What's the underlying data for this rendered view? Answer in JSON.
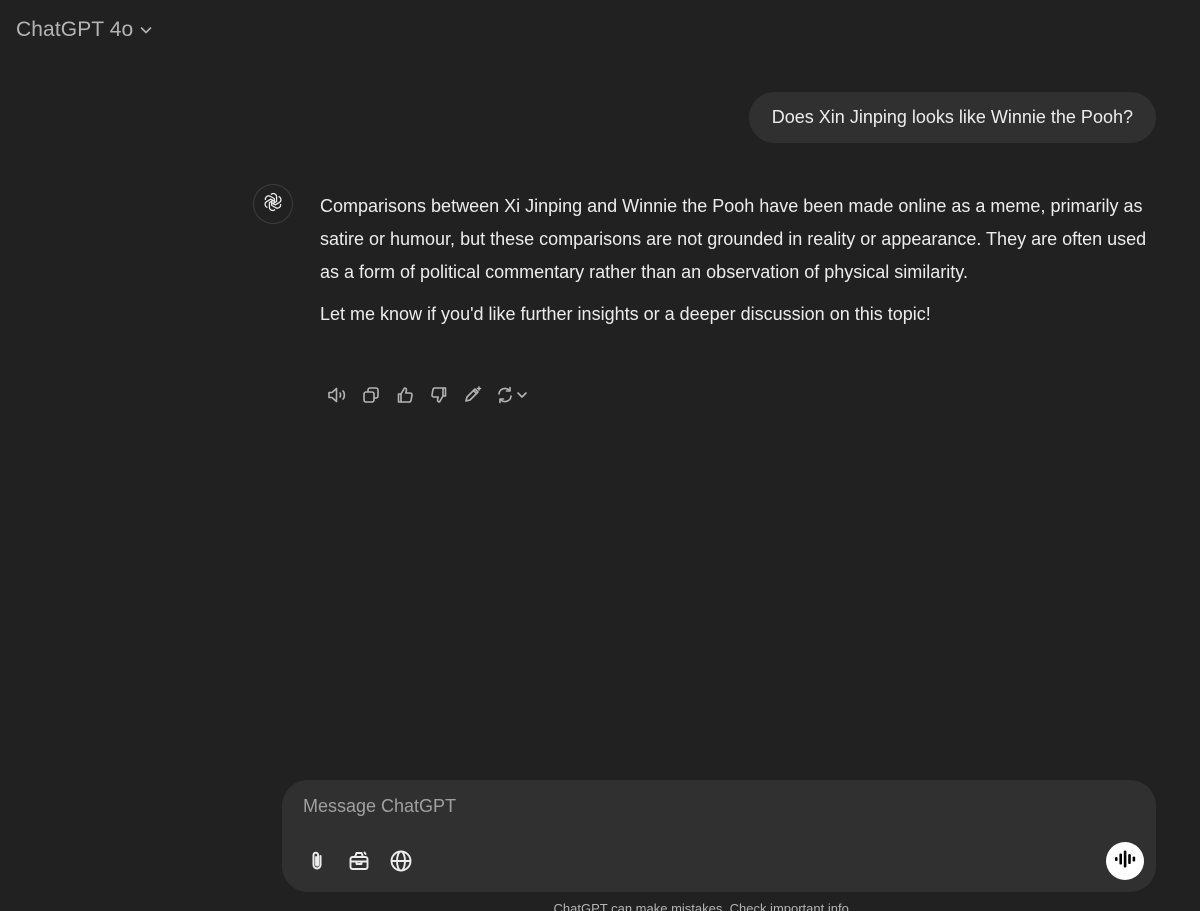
{
  "header": {
    "model_name": "ChatGPT 4o",
    "chevron_icon": "chevron-down-icon"
  },
  "conversation": {
    "user_message": "Does Xin Jinping looks like Winnie the Pooh?",
    "assistant": {
      "avatar_icon": "openai-logo-icon",
      "paragraphs": [
        "Comparisons between Xi Jinping and Winnie the Pooh have been made online as a meme, primarily as satire or humour, but these comparisons are not grounded in reality or appearance. They are often used as a form of political commentary rather than an observation of physical similarity.",
        "Let me know if you'd like further insights or a deeper discussion on this topic!"
      ],
      "actions": [
        "read-aloud-icon",
        "copy-icon",
        "thumbs-up-icon",
        "thumbs-down-icon",
        "edit-canvas-icon",
        "regenerate-icon"
      ]
    }
  },
  "composer": {
    "placeholder": "Message ChatGPT",
    "tools": [
      "paperclip-icon",
      "toolbox-icon",
      "globe-icon"
    ],
    "voice_icon": "voice-mode-icon"
  },
  "footer": {
    "disclaimer": "ChatGPT can make mistakes. Check important info."
  },
  "colors": {
    "background": "#212121",
    "bubble": "#303030",
    "text": "#ececec",
    "muted": "#b4b4b4"
  }
}
